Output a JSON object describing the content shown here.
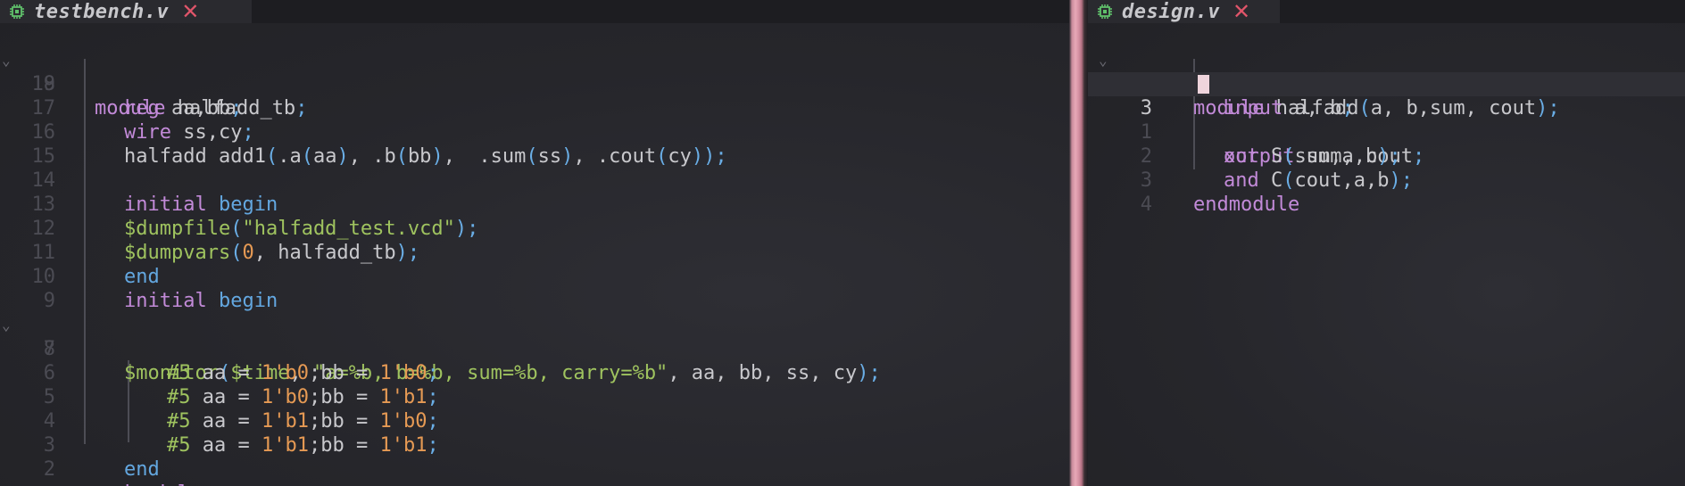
{
  "colors": {
    "keyword": "#c28ad8",
    "keyword_block": "#63a7e0",
    "string": "#9fc35f",
    "number": "#e69a54",
    "punctuation": "#6aaee6",
    "text": "#c8c8cc",
    "close_icon": "#e0556a",
    "chip_icon": "#5fbf6a"
  },
  "left_pane": {
    "tab": {
      "title": "testbench.v",
      "icon": "chip-icon",
      "close": "✕"
    },
    "lines": [
      {
        "n": "19",
        "fold": "⌄",
        "code": "module halfadd_tb;"
      },
      {
        "n": "18",
        "code": "reg aa,bb;"
      },
      {
        "n": "17",
        "code": "wire ss,cy;"
      },
      {
        "n": "16",
        "code": "halfadd add1(.a(aa), .b(bb),  .sum(ss), .cout(cy));"
      },
      {
        "n": "15",
        "code": ""
      },
      {
        "n": "14",
        "code": "initial begin"
      },
      {
        "n": "13",
        "code": "$dumpfile(\"halfadd_test.vcd\");"
      },
      {
        "n": "12",
        "code": "$dumpvars(0, halfadd_tb);"
      },
      {
        "n": "11",
        "code": "end"
      },
      {
        "n": "10",
        "code": "initial begin"
      },
      {
        "n": "9",
        "code": ""
      },
      {
        "n": "8",
        "fold": "⌄",
        "code": "$monitor($time, \"a=%b, b=%b, sum=%b, carry=%b\", aa, bb, ss, cy);"
      },
      {
        "n": "7",
        "code": "#5 aa = 1'b0;bb = 1'b0;"
      },
      {
        "n": "6",
        "code": "#5 aa = 1'b0;bb = 1'b1;"
      },
      {
        "n": "5",
        "code": "#5 aa = 1'b1;bb = 1'b0;"
      },
      {
        "n": "4",
        "code": "#5 aa = 1'b1;bb = 1'b1;"
      },
      {
        "n": "3",
        "code": "end"
      },
      {
        "n": "2",
        "code": "endmodule"
      }
    ]
  },
  "right_pane": {
    "tab": {
      "title": "design.v",
      "icon": "chip-icon",
      "close": "✕"
    },
    "lines": [
      {
        "n": "2",
        "fold": "⌄",
        "code": "module halfadd(a, b,sum, cout);"
      },
      {
        "n": "1",
        "code": "input a, b;"
      },
      {
        "n": "3",
        "code": "output sum, cout;"
      },
      {
        "n": "1",
        "code": "xor S(sum,a,b);"
      },
      {
        "n": "2",
        "code": "and C(cout,a,b);"
      },
      {
        "n": "3",
        "code": "endmodule"
      },
      {
        "n": "4",
        "code": ""
      }
    ]
  }
}
